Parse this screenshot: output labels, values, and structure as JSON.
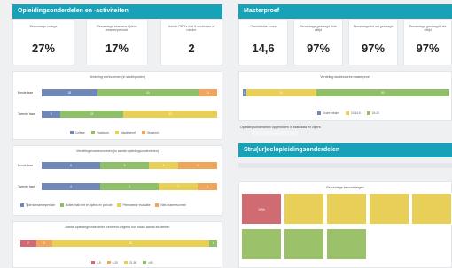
{
  "left_header": "Opleidingsonderdelen en -activiteiten",
  "right_header": "Masterproef",
  "kpis_left": [
    {
      "label": "Percentage collega",
      "value": "27%"
    },
    {
      "label": "Percentage examens tijdens examenperiode",
      "value": "17%"
    },
    {
      "label": "Aantal OPO's met 5 studenten of minder",
      "value": "2"
    }
  ],
  "kpis_right": [
    {
      "label": "Gemiddelde score",
      "value": "14,6"
    },
    {
      "label": "Percentage geslaagd 1ste zittijd",
      "value": "97%"
    },
    {
      "label": "Percentage tot aal geslaagd",
      "value": "97%"
    },
    {
      "label": "Percentage geslaagd 1ste zittijd",
      "value": "97%"
    }
  ],
  "chart1": {
    "title": "Verdeling werkvormen (in studiepunten)",
    "rows": [
      "Eerste fase",
      "Tweede fase"
    ],
    "legend": [
      "College",
      "Practicum",
      "Masterproef",
      "Stage/ed"
    ],
    "colors": [
      "#7088b8",
      "#8fbf68",
      "#e8cf57",
      "#f0a55c"
    ]
  },
  "chart2": {
    "title": "Verdeling examenvormen (in aantal opleidingsonderdelen)",
    "rows": [
      "Eerste fase",
      "Tweede fase"
    ],
    "legend": [
      "Tijdens examenperiode",
      "Buiten mail met en tijdens en periode",
      "Permanente evaluatie",
      "Niet-examenvormen"
    ]
  },
  "chart3": {
    "title": "Aantal opleidingsonderdelen verdeeld volgens hun totaal aantal studenten",
    "legend": [
      "1-5",
      "6-20",
      "21-50",
      ">50"
    ]
  },
  "chart4": {
    "title": "Verdeling studiescores masterproef",
    "legend": [
      "Score:minder",
      "10-14,5",
      "15-20"
    ],
    "note": "Opleidingsonderdelen opgenomen in basisdata en cijfers"
  },
  "chart5": {
    "header": "Stru(ur)eelopleidingsonderdelen",
    "title": "Percentage beoordelingen"
  },
  "chart_data": [
    {
      "type": "bar",
      "title": "Verdeling werkvormen (in studiepunten)",
      "categories": [
        "Eerste fase",
        "Tweede fase"
      ],
      "series": [
        {
          "name": "College",
          "values": [
            18,
            6
          ]
        },
        {
          "name": "Practicum",
          "values": [
            33,
            20
          ]
        },
        {
          "name": "Masterproef",
          "values": [
            0,
            30
          ]
        },
        {
          "name": "Stage/ed",
          "values": [
            6,
            0
          ]
        }
      ],
      "labels": [
        [
          "18",
          "40",
          "",
          "11"
        ],
        [
          "5",
          "23",
          "33",
          ""
        ]
      ]
    },
    {
      "type": "bar",
      "title": "Verdeling examenvormen (in aantal opleidingsonderdelen)",
      "categories": [
        "Eerste fase",
        "Tweede fase"
      ],
      "series": [
        {
          "name": "Tijdens examenperiode",
          "values": [
            6,
            6
          ]
        },
        {
          "name": "Buiten mail met en tijdens en periode",
          "values": [
            5,
            6
          ]
        },
        {
          "name": "Permanente evaluatie",
          "values": [
            3,
            4
          ]
        },
        {
          "name": "Niet-examenvormen",
          "values": [
            4,
            2
          ]
        }
      ],
      "labels": [
        [
          "6",
          "5",
          "1",
          "1"
        ],
        [
          "4",
          "2",
          "7",
          "1"
        ]
      ]
    },
    {
      "type": "bar",
      "title": "Aantal opleidingsonderdelen verdeeld volgens hun totaal aantal studenten",
      "categories": [
        ""
      ],
      "series": [
        {
          "name": "1-5",
          "values": [
            2
          ]
        },
        {
          "name": "6-20",
          "values": [
            2
          ]
        },
        {
          "name": "21-50",
          "values": [
            20
          ]
        },
        {
          "name": ">50",
          "values": [
            1
          ]
        }
      ],
      "labels": [
        [
          "2",
          "3",
          "19",
          "1"
        ]
      ]
    },
    {
      "type": "bar",
      "title": "Verdeling studiescores masterproef",
      "categories": [
        ""
      ],
      "series": [
        {
          "name": "Score:minder",
          "values": [
            1
          ]
        },
        {
          "name": "10-14,5",
          "values": [
            21
          ]
        },
        {
          "name": "15-20",
          "values": [
            40
          ]
        }
      ],
      "labels": [
        [
          "1",
          "11",
          "50"
        ]
      ]
    }
  ],
  "tiles": [
    {
      "label": "19%",
      "color": "#cf6b71"
    },
    {
      "label": "",
      "color": "#e8cf57"
    },
    {
      "label": "",
      "color": "#e8cf57"
    },
    {
      "label": "",
      "color": "#e8cf57"
    },
    {
      "label": "",
      "color": "#e8cf57"
    },
    {
      "label": "",
      "color": "#9bc26a"
    },
    {
      "label": "",
      "color": "#9bc26a"
    },
    {
      "label": "",
      "color": "#9bc26a"
    }
  ]
}
